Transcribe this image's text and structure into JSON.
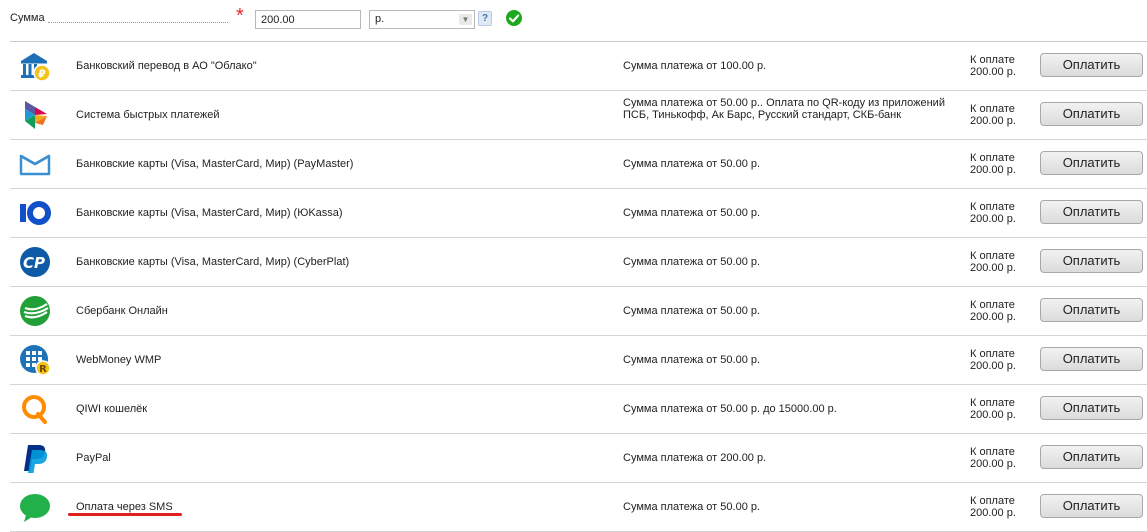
{
  "form": {
    "amount_label": "Сумма",
    "amount_value": "200.00",
    "currency_value": "р.",
    "help_label": "?"
  },
  "methods": [
    {
      "name": "Банковский перевод в АО \"Облако\"",
      "desc": "Сумма платежа от 100.00 р.",
      "to_pay_label": "К оплате",
      "to_pay_amount": "200.00 р.",
      "button": "Оплатить",
      "icon": "bank-icon"
    },
    {
      "name": "Система быстрых платежей",
      "desc": "Сумма платежа от 50.00 р.. Оплата по QR-коду из приложений ПСБ, Тинькофф, Ак Барс, Русский стандарт, СКБ-банк",
      "to_pay_label": "К оплате",
      "to_pay_amount": "200.00 р.",
      "button": "Оплатить",
      "icon": "sbp-icon"
    },
    {
      "name": "Банковские карты (Visa, MasterCard, Мир) (PayMaster)",
      "desc": "Сумма платежа от 50.00 р.",
      "to_pay_label": "К оплате",
      "to_pay_amount": "200.00 р.",
      "button": "Оплатить",
      "icon": "paymaster-icon"
    },
    {
      "name": "Банковские карты (Visa, MasterCard, Мир) (ЮKassa)",
      "desc": "Сумма платежа от 50.00 р.",
      "to_pay_label": "К оплате",
      "to_pay_amount": "200.00 р.",
      "button": "Оплатить",
      "icon": "yookassa-icon"
    },
    {
      "name": "Банковские карты (Visa, MasterCard, Мир) (CyberPlat)",
      "desc": "Сумма платежа от 50.00 р.",
      "to_pay_label": "К оплате",
      "to_pay_amount": "200.00 р.",
      "button": "Оплатить",
      "icon": "cyberplat-icon"
    },
    {
      "name": "Сбербанк Онлайн",
      "desc": "Сумма платежа от 50.00 р.",
      "to_pay_label": "К оплате",
      "to_pay_amount": "200.00 р.",
      "button": "Оплатить",
      "icon": "sberbank-icon"
    },
    {
      "name": "WebMoney WMP",
      "desc": "Сумма платежа от 50.00 р.",
      "to_pay_label": "К оплате",
      "to_pay_amount": "200.00 р.",
      "button": "Оплатить",
      "icon": "webmoney-icon"
    },
    {
      "name": "QIWI кошелёк",
      "desc": "Сумма платежа от 50.00 р. до 15000.00 р.",
      "to_pay_label": "К оплате",
      "to_pay_amount": "200.00 р.",
      "button": "Оплатить",
      "icon": "qiwi-icon"
    },
    {
      "name": "PayPal",
      "desc": "Сумма платежа от 200.00 р.",
      "to_pay_label": "К оплате",
      "to_pay_amount": "200.00 р.",
      "button": "Оплатить",
      "icon": "paypal-icon"
    },
    {
      "name": "Оплата через SMS",
      "desc": "Сумма платежа от 50.00 р.",
      "to_pay_label": "К оплате",
      "to_pay_amount": "200.00 р.",
      "button": "Оплатить",
      "icon": "sms-icon"
    }
  ],
  "colors": {
    "accent_red": "#e0201f",
    "ok_green": "#1ea81e",
    "brand_blue": "#1d6fb8"
  }
}
